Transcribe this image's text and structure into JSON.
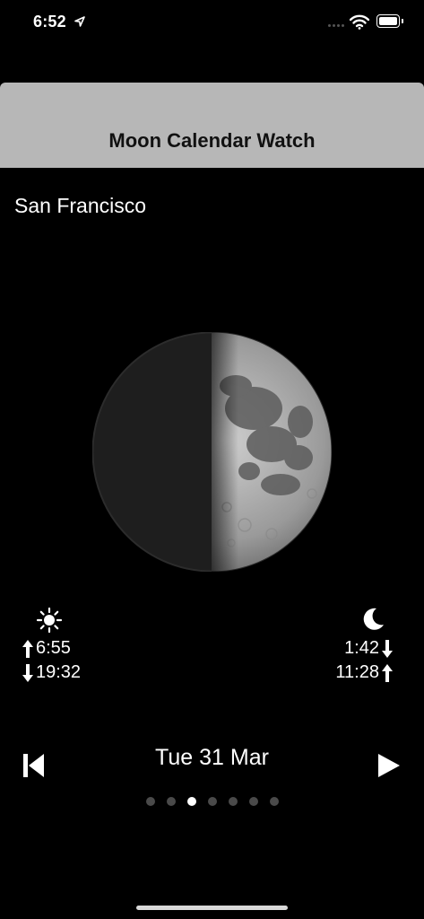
{
  "status_bar": {
    "time": "6:52",
    "icons": [
      "location-arrow-icon",
      "cellular-signal-icon",
      "wifi-icon",
      "battery-icon"
    ]
  },
  "nav": {
    "title": "Moon Calendar Watch"
  },
  "location": {
    "city": "San Francisco"
  },
  "moon_phase": {
    "icon": "moon-phase-image",
    "illumination_side": "right",
    "illuminated_fraction": 0.5
  },
  "sun": {
    "icon": "sun-icon",
    "rise": "6:55",
    "set": "19:32"
  },
  "moon": {
    "icon": "crescent-moon-icon",
    "set_time": "1:42",
    "rise_time": "11:28"
  },
  "date_nav": {
    "date": "Tue 31 Mar",
    "prev_icon": "skip-back-icon",
    "next_icon": "play-icon"
  },
  "pager": {
    "count": 7,
    "active_index": 2
  },
  "colors": {
    "background": "#000000",
    "nav_bar": "#b7b7b7",
    "text": "#ffffff"
  }
}
